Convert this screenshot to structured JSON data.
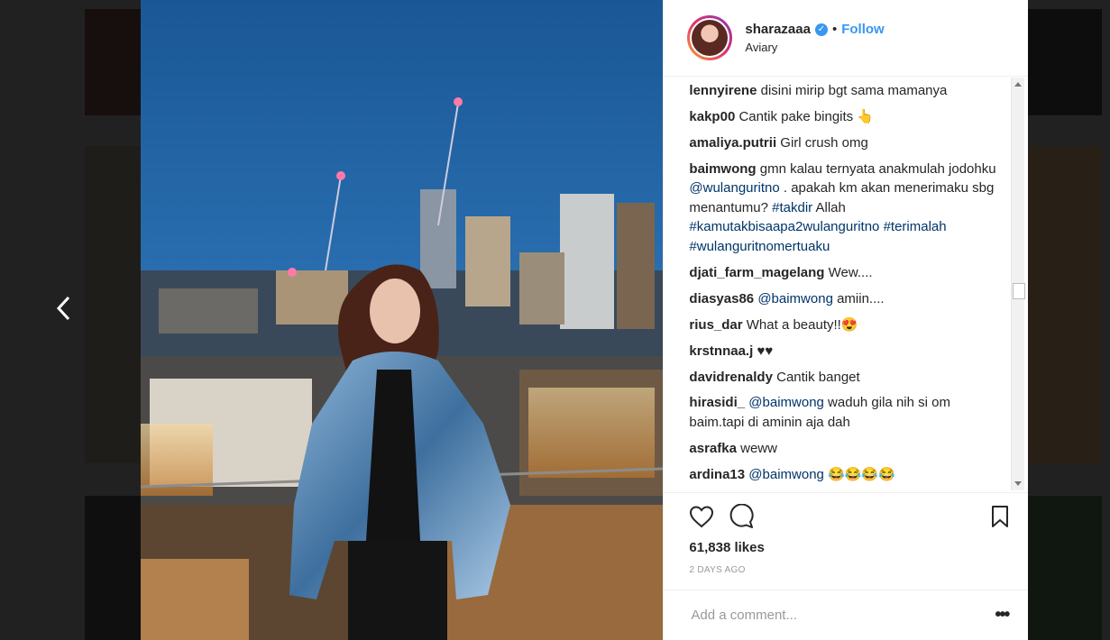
{
  "post": {
    "username": "sharazaaa",
    "verified": true,
    "separator": "•",
    "follow_label": "Follow",
    "location": "Aviary",
    "likes": "61,838 likes",
    "time": "2 DAYS AGO",
    "add_comment_placeholder": "Add a comment...",
    "more_label": "•••",
    "comments": [
      {
        "user": "lennyirene",
        "parts": [
          {
            "t": " disini mirip bgt sama mamanya"
          }
        ]
      },
      {
        "user": "kakp00",
        "parts": [
          {
            "t": " Cantik pake bingits 👆"
          }
        ]
      },
      {
        "user": "amaliya.putrii",
        "parts": [
          {
            "t": " Girl crush omg"
          }
        ]
      },
      {
        "user": "baimwong",
        "parts": [
          {
            "t": " gmn kalau ternyata anakmulah jodohku "
          },
          {
            "t": "@wulanguritno",
            "link": true
          },
          {
            "t": " . apakah km akan menerimaku sbg menantumu? "
          },
          {
            "t": "#takdir",
            "link": true
          },
          {
            "t": " Allah "
          },
          {
            "t": "#kamutakbisaapa2wulanguritno",
            "link": true
          },
          {
            "t": " "
          },
          {
            "t": "#terimalah",
            "link": true
          },
          {
            "t": " "
          },
          {
            "t": "#wulanguritnomertuaku",
            "link": true
          }
        ]
      },
      {
        "user": "djati_farm_magelang",
        "parts": [
          {
            "t": " Wew...."
          }
        ]
      },
      {
        "user": "diasyas86",
        "parts": [
          {
            "t": " "
          },
          {
            "t": "@baimwong",
            "link": true
          },
          {
            "t": " amiin...."
          }
        ]
      },
      {
        "user": "rius_dar",
        "parts": [
          {
            "t": " What a beauty!!😍"
          }
        ]
      },
      {
        "user": "krstnnaa.j",
        "parts": [
          {
            "t": " ♥♥"
          }
        ]
      },
      {
        "user": "davidrenaldy",
        "parts": [
          {
            "t": " Cantik banget"
          }
        ]
      },
      {
        "user": "hirasidi_",
        "parts": [
          {
            "t": " "
          },
          {
            "t": "@baimwong",
            "link": true
          },
          {
            "t": " waduh gila nih si om baim.tapi di aminin aja dah"
          }
        ]
      },
      {
        "user": "asrafka",
        "parts": [
          {
            "t": " weww"
          }
        ]
      },
      {
        "user": "ardina13",
        "parts": [
          {
            "t": " "
          },
          {
            "t": "@baimwong",
            "link": true
          },
          {
            "t": " 😂😂😂😂"
          }
        ]
      }
    ]
  },
  "icons": {
    "prev": "chevron-left-icon",
    "like": "heart-icon",
    "comment": "comment-icon",
    "save": "bookmark-icon",
    "verified": "verified-badge-icon"
  },
  "colors": {
    "link": "#003569",
    "follow": "#3897f0",
    "sky": "#1f5e9c"
  }
}
